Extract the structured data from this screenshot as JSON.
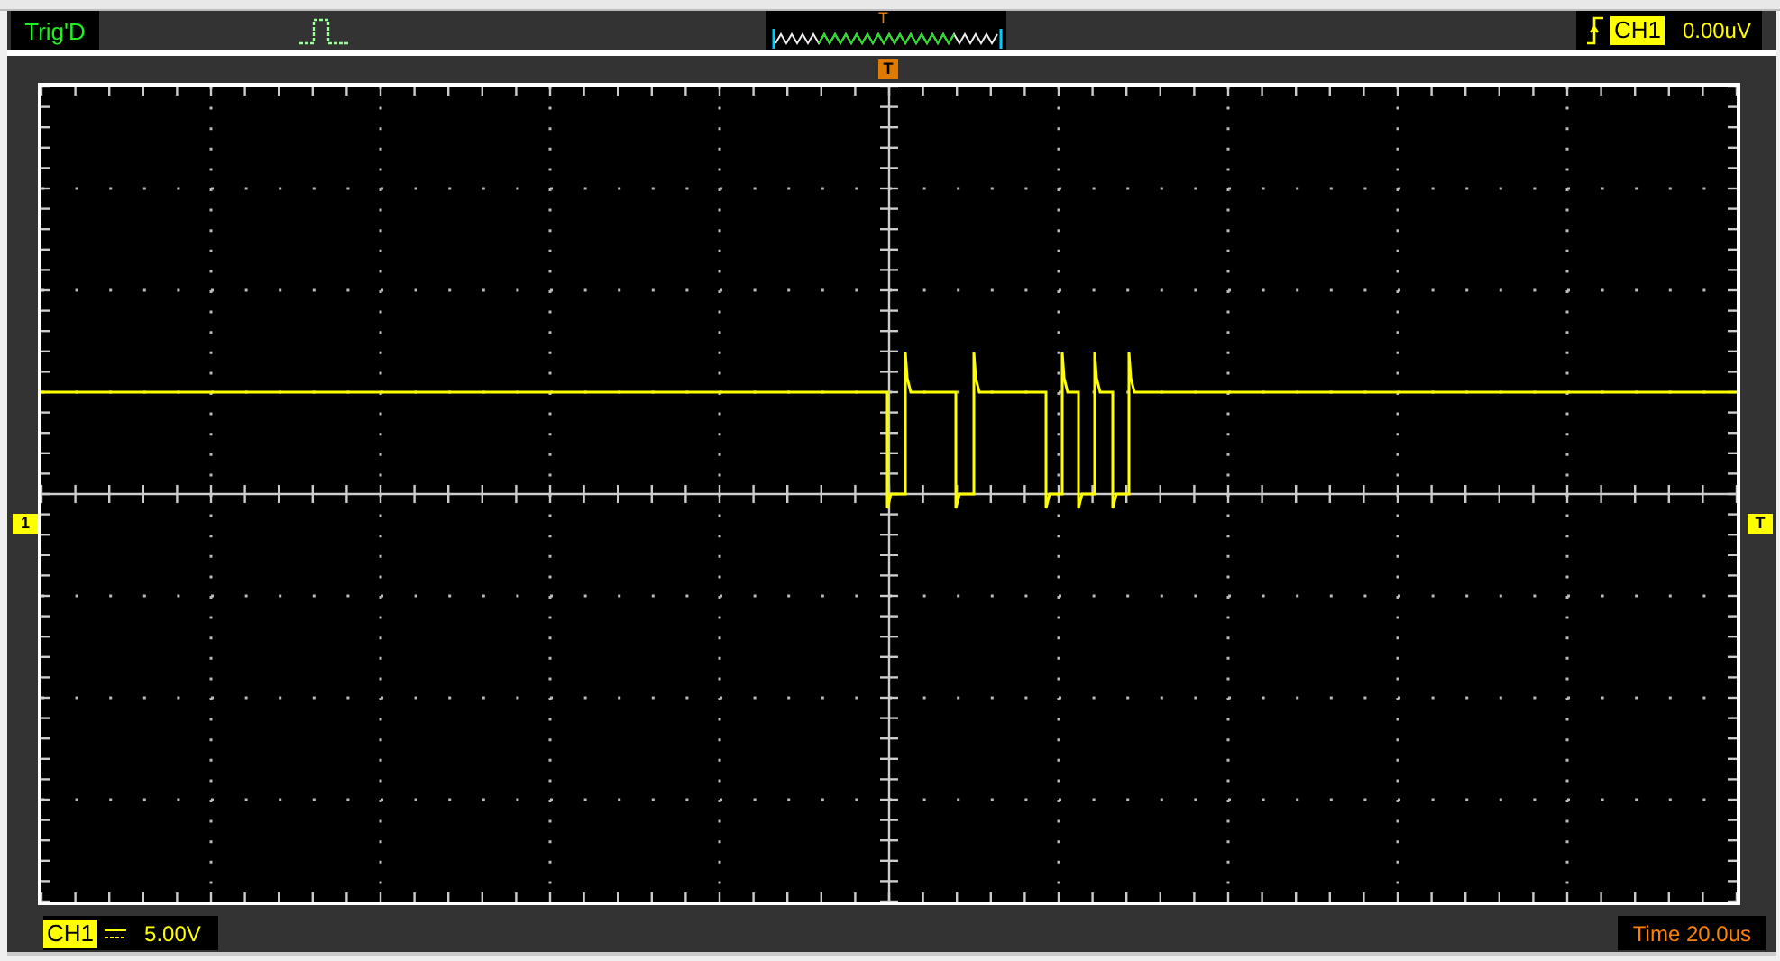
{
  "header": {
    "status": "Trig'D",
    "trigger_channel": "CH1",
    "trigger_level": "0.00uV",
    "trigger_marker": "T"
  },
  "scope": {
    "top_marker": "T",
    "channel_marker": "1",
    "level_marker": "T"
  },
  "footer": {
    "channel": "CH1",
    "volts_per_div": "5.00V",
    "timebase": "Time 20.0us"
  }
}
